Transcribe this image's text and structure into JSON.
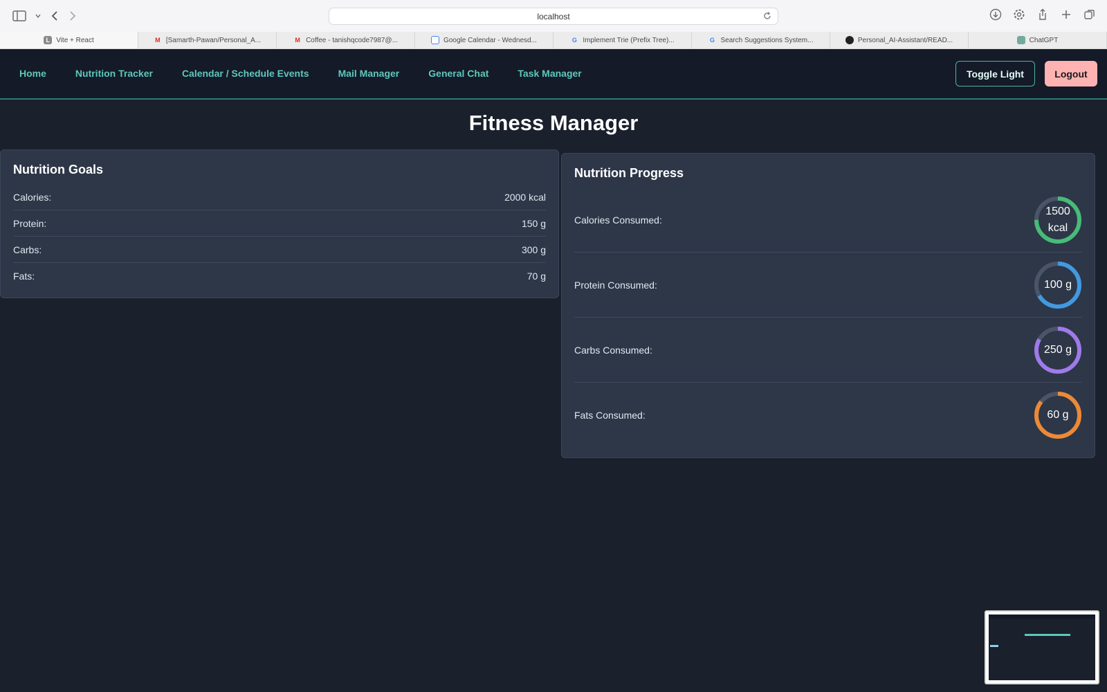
{
  "browser": {
    "url": "localhost",
    "tabs": [
      {
        "label": "Vite + React",
        "icon": "vite-icon",
        "active": true
      },
      {
        "label": "[Samarth-Pawan/Personal_A...",
        "icon": "gmail-icon"
      },
      {
        "label": "Coffee - tanishqcode7987@...",
        "icon": "gmail-icon"
      },
      {
        "label": "Google Calendar - Wednesd...",
        "icon": "calendar-icon"
      },
      {
        "label": "Implement Trie (Prefix Tree)...",
        "icon": "google-icon"
      },
      {
        "label": "Search Suggestions System...",
        "icon": "google-icon"
      },
      {
        "label": "Personal_AI-Assistant/READ...",
        "icon": "github-icon"
      },
      {
        "label": "ChatGPT",
        "icon": "chatgpt-icon"
      }
    ]
  },
  "nav": {
    "links": [
      "Home",
      "Nutrition Tracker",
      "Calendar / Schedule Events",
      "Mail Manager",
      "General Chat",
      "Task Manager"
    ],
    "toggle_label": "Toggle Light",
    "logout_label": "Logout"
  },
  "page": {
    "title": "Fitness Manager"
  },
  "goals": {
    "title": "Nutrition Goals",
    "rows": [
      {
        "label": "Calories:",
        "value": "2000 kcal"
      },
      {
        "label": "Protein:",
        "value": "150 g"
      },
      {
        "label": "Carbs:",
        "value": "300 g"
      },
      {
        "label": "Fats:",
        "value": "70 g"
      }
    ]
  },
  "progress": {
    "title": "Nutrition Progress",
    "rows": [
      {
        "label": "Calories Consumed:",
        "value": "1500 kcal",
        "fraction": 0.75,
        "color": "#48bb78"
      },
      {
        "label": "Protein Consumed:",
        "value": "100 g",
        "fraction": 0.667,
        "color": "#4299e1"
      },
      {
        "label": "Carbs Consumed:",
        "value": "250 g",
        "fraction": 0.833,
        "color": "#9f7aea"
      },
      {
        "label": "Fats Consumed:",
        "value": "60 g",
        "fraction": 0.857,
        "color": "#ed8936"
      }
    ]
  },
  "colors": {
    "accent": "#5ec8bd",
    "logout": "#feb2b2",
    "card": "#2d3748",
    "ring_track": "#4a5568"
  }
}
